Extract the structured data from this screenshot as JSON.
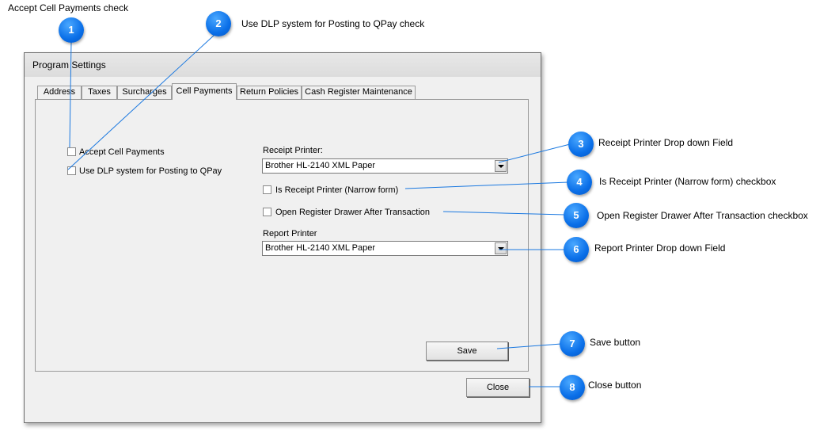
{
  "window": {
    "title": "Program Settings"
  },
  "tabs": [
    {
      "label": "Address"
    },
    {
      "label": "Taxes"
    },
    {
      "label": "Surcharges"
    },
    {
      "label": "Cell Payments",
      "active": true
    },
    {
      "label": "Return Policies"
    },
    {
      "label": "Cash Register Maintenance"
    }
  ],
  "cell_payments": {
    "accept_cell_payments": {
      "label": "Accept Cell Payments",
      "checked": false
    },
    "use_dlp": {
      "label": "Use DLP system for Posting to QPay",
      "checked": false
    },
    "receipt_printer": {
      "label": "Receipt Printer:",
      "value": "Brother HL-2140 XML Paper"
    },
    "is_receipt_printer_narrow": {
      "label": "Is Receipt Printer (Narrow form)",
      "checked": false
    },
    "open_register_drawer": {
      "label": "Open Register Drawer After Transaction",
      "checked": false
    },
    "report_printer": {
      "label": "Report Printer",
      "value": "Brother HL-2140 XML Paper"
    },
    "save_label": "Save"
  },
  "close_label": "Close",
  "callouts": [
    {
      "number": "1",
      "text": "Accept Cell Payments check"
    },
    {
      "number": "2",
      "text": "Use DLP system for Posting to QPay check"
    },
    {
      "number": "3",
      "text": "Receipt Printer Drop down Field"
    },
    {
      "number": "4",
      "text": "Is Receipt Printer (Narrow form) checkbox"
    },
    {
      "number": "5",
      "text": "Open Register Drawer After Transaction checkbox"
    },
    {
      "number": "6",
      "text": "Report Printer Drop down Field"
    },
    {
      "number": "7",
      "text": "Save button"
    },
    {
      "number": "8",
      "text": "Close button"
    }
  ],
  "colors": {
    "accent": "#0a6fe8",
    "window_bg": "#f0f0f0"
  }
}
